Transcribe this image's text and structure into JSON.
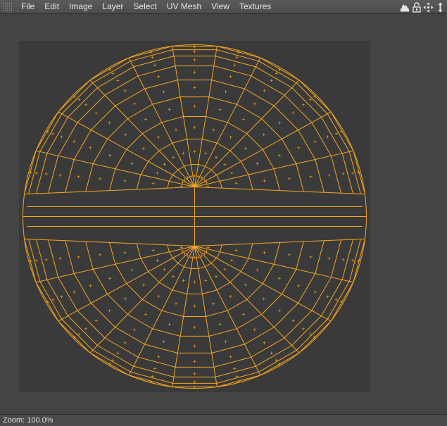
{
  "menubar": {
    "items": [
      {
        "id": "file",
        "label": "File"
      },
      {
        "id": "edit",
        "label": "Edit"
      },
      {
        "id": "image",
        "label": "Image"
      },
      {
        "id": "layer",
        "label": "Layer"
      },
      {
        "id": "select",
        "label": "Select"
      },
      {
        "id": "uv-mesh",
        "label": "UV Mesh"
      },
      {
        "id": "view",
        "label": "View"
      },
      {
        "id": "textures",
        "label": "Textures"
      }
    ],
    "tools": [
      "histogram-icon",
      "lock-icon",
      "move-icon",
      "pan-icon"
    ]
  },
  "uv_editor": {
    "wire_color": "#f5a623",
    "canvas_color": "#3a3a3a",
    "sphere": {
      "rings": 12,
      "segments": 24
    }
  },
  "status": {
    "zoom_text": "Zoom: 100.0%"
  }
}
